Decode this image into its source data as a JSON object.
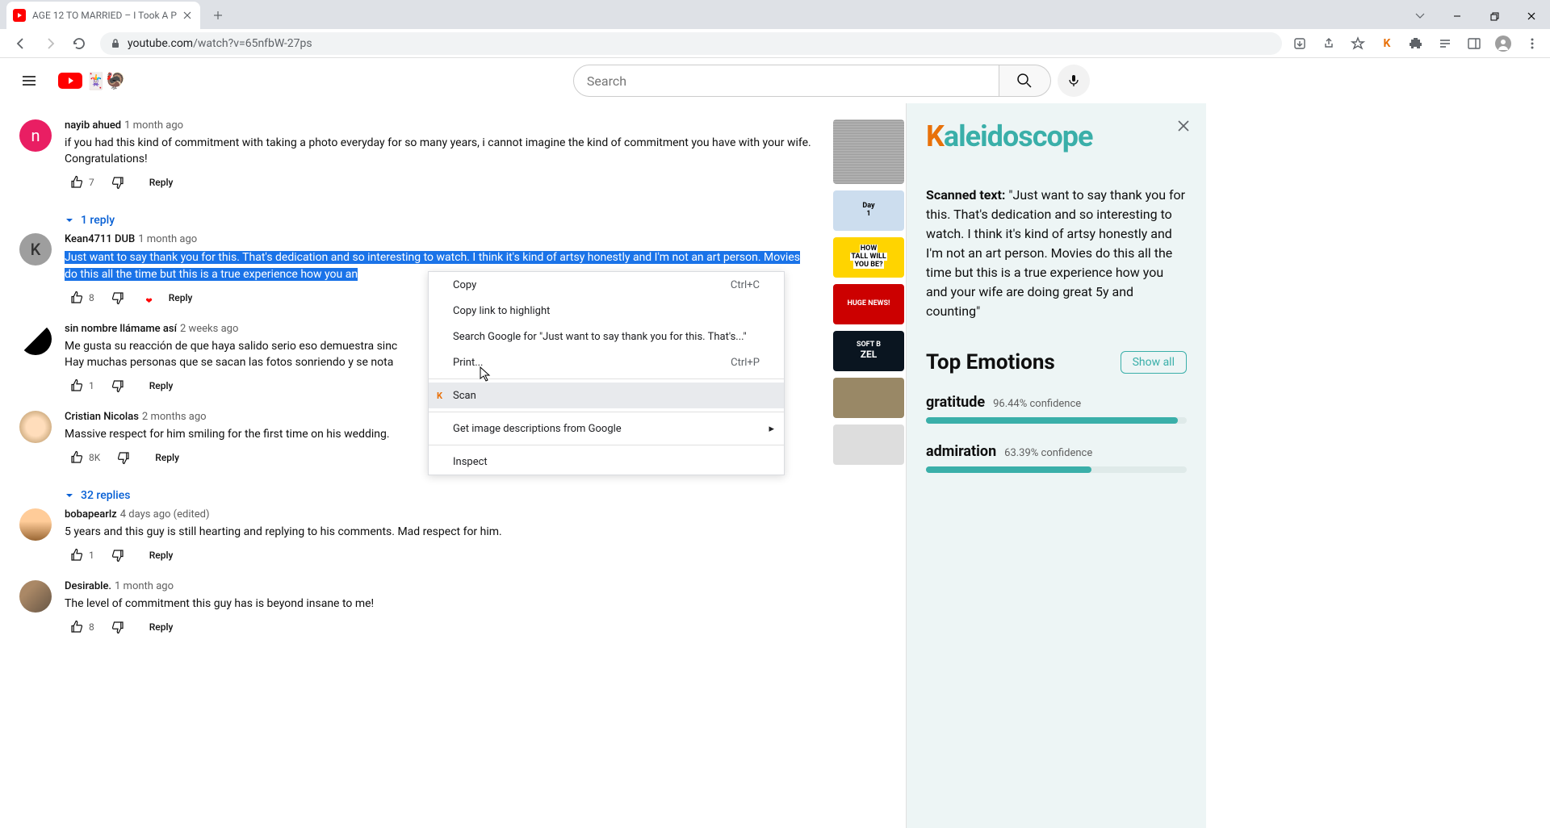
{
  "browser": {
    "tab_title": "AGE 12 TO MARRIED – I Took A P",
    "url_host": "youtube.com",
    "url_path": "/watch?v=65nfbW-27ps",
    "window_controls": {
      "minimize": "−",
      "maximize": "❐",
      "close": "✕"
    }
  },
  "yt": {
    "search_placeholder": "Search"
  },
  "comments": [
    {
      "author": "nayib ahued",
      "time": "1 month ago",
      "text": "if you had this kind of commitment with taking a photo everyday for so many years, i cannot imagine the kind of commitment you have with your wife. Congratulations!",
      "likes": "7",
      "reply": "Reply",
      "replies_toggle": "1 reply",
      "avatar_class": "pink",
      "avatar_letter": "n"
    },
    {
      "author": "Kean4711 DUB",
      "time": "1 month ago",
      "text": "Just want to say thank you for this.  That's dedication and so interesting to watch.  I think it's kind of artsy honestly and I'm not an art person.  Movies do this all the time but this is a true experience how you an",
      "likes": "8",
      "reply": "Reply",
      "highlighted": true,
      "hearted": true,
      "avatar_class": "gray",
      "avatar_letter": "K"
    },
    {
      "author": "sin nombre llámame así",
      "time": "2 weeks ago",
      "text": "Me gusta su reacción de que haya salido serio eso demuestra sinc\nHay muchas personas que se sacan las fotos sonriendo y se nota",
      "likes": "1",
      "reply": "Reply",
      "avatar_class": "img1"
    },
    {
      "author": "Cristian Nicolas",
      "time": "2 months ago",
      "text": "Massive respect for him smiling for the first time on his wedding.",
      "likes": "8K",
      "reply": "Reply",
      "replies_toggle": "32 replies",
      "avatar_class": "img2"
    },
    {
      "author": "bobapearlz",
      "time": "4 days ago (edited)",
      "text": "5 years and this guy is still hearting and replying to his comments. Mad respect for him.",
      "likes": "1",
      "reply": "Reply",
      "avatar_class": "img3"
    },
    {
      "author": "Desirable.",
      "time": "1 month ago",
      "text": "The level of commitment this guy has is beyond insane to me!",
      "likes": "8",
      "reply": "Reply",
      "avatar_class": "img4"
    }
  ],
  "thumb_texts": {
    "t2a": "Day",
    "t2b": "1",
    "t3a": "HOW",
    "t3b": "TALL WILL",
    "t3c": "YOU BE?",
    "t4": "HUGE NEWS!",
    "t5a": "SOFT B",
    "t5b": "ZEL"
  },
  "context_menu": {
    "copy": "Copy",
    "copy_shortcut": "Ctrl+C",
    "copy_link": "Copy link to highlight",
    "search": "Search Google for \"Just want to say thank you for this.  That's...\"",
    "print": "Print...",
    "print_shortcut": "Ctrl+P",
    "scan": "Scan",
    "image_desc": "Get image descriptions from Google",
    "inspect": "Inspect"
  },
  "extension": {
    "logo_rest": "aleidoscope",
    "scanned_label": "Scanned text:",
    "scanned_text": " \"Just want to say thank you for this. That's dedication and so interesting to watch. I think it's kind of artsy honestly and I'm not an art person. Movies do this all the time but this is a true experience how you and your wife are doing great 5y and counting\"",
    "emotions_title": "Top Emotions",
    "show_all": "Show all",
    "emotions": [
      {
        "name": "gratitude",
        "confidence": "96.44% confidence",
        "width": "96.44%"
      },
      {
        "name": "admiration",
        "confidence": "63.39% confidence",
        "width": "63.39%"
      }
    ]
  }
}
